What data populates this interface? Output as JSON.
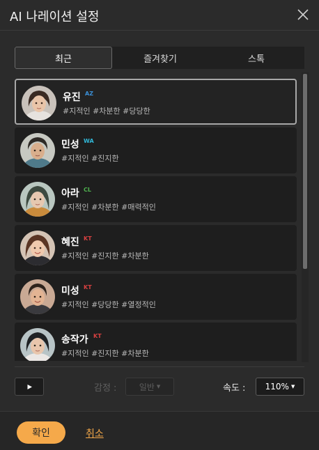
{
  "window": {
    "title": "AI 나레이션 설정",
    "close_icon": "close-icon"
  },
  "tabs": [
    {
      "label": "최근",
      "active": true
    },
    {
      "label": "즐겨찾기",
      "active": false
    },
    {
      "label": "스톡",
      "active": false
    }
  ],
  "voices": [
    {
      "name": "유진",
      "badge": "AZ",
      "badge_color": "#3b8fd6",
      "tags": "#지적인 #차분한 #당당한",
      "selected": true
    },
    {
      "name": "민성",
      "badge": "WA",
      "badge_color": "#31b8d8",
      "tags": "#지적인 #진지한",
      "selected": false
    },
    {
      "name": "아라",
      "badge": "CL",
      "badge_color": "#4fb34f",
      "tags": "#지적인 #차분한 #매력적인",
      "selected": false
    },
    {
      "name": "혜진",
      "badge": "KT",
      "badge_color": "#d64040",
      "tags": "#지적인 #진지한 #차분한",
      "selected": false
    },
    {
      "name": "미성",
      "badge": "KT",
      "badge_color": "#d64040",
      "tags": "#지적인 #당당한 #열정적인",
      "selected": false
    },
    {
      "name": "송작가",
      "badge": "KT",
      "badge_color": "#d64040",
      "tags": "#지적인 #진지한 #차분한",
      "selected": false
    }
  ],
  "controls": {
    "play_icon": "play-icon",
    "emotion_label": "감정 :",
    "emotion_value": "일반",
    "speed_label": "속도 :",
    "speed_value": "110%"
  },
  "footer": {
    "ok_label": "확인",
    "cancel_label": "취소"
  },
  "colors": {
    "accent": "#f5a94a",
    "background": "#2b2b2b",
    "card": "#1e1e1e"
  }
}
